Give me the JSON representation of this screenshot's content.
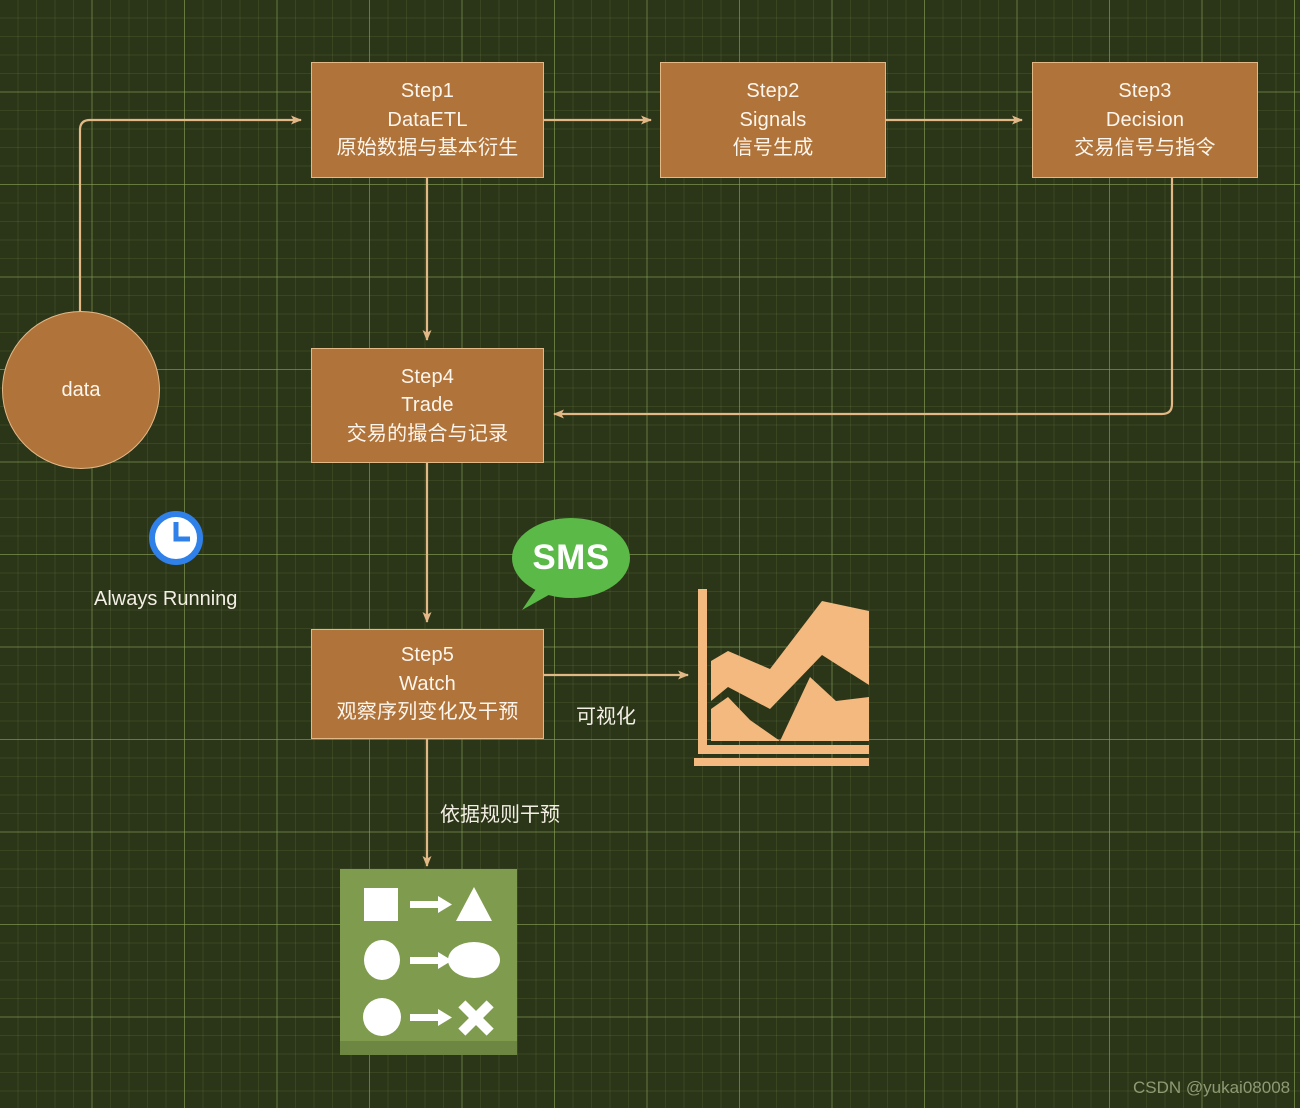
{
  "diagram": {
    "title": "Quant trading pipeline flowchart",
    "background_color": "#2b3518",
    "grid_color": "#8aa359",
    "node_fill": "#b0743a",
    "node_border": "#e3b887",
    "connector_color": "#e3b887",
    "nodes": [
      {
        "id": "data",
        "shape": "circle",
        "label": "data"
      },
      {
        "id": "step1",
        "shape": "rect",
        "line1": "Step1",
        "line2": "DataETL",
        "line3": "原始数据与基本衍生"
      },
      {
        "id": "step2",
        "shape": "rect",
        "line1": "Step2",
        "line2": "Signals",
        "line3": "信号生成"
      },
      {
        "id": "step3",
        "shape": "rect",
        "line1": "Step3",
        "line2": "Decision",
        "line3": "交易信号与指令"
      },
      {
        "id": "step4",
        "shape": "rect",
        "line1": "Step4",
        "line2": "Trade",
        "line3": "交易的撮合与记录"
      },
      {
        "id": "step5",
        "shape": "rect",
        "line1": "Step5",
        "line2": "Watch",
        "line3": "观察序列变化及干预"
      }
    ],
    "edge_labels": {
      "visualize": "可视化",
      "rule_intervene": "依据规则干预"
    },
    "annotations": {
      "always_running": "Always Running",
      "sms_badge": "SMS"
    },
    "icons": {
      "clock": "clock-icon",
      "sms": "sms-bubble-icon",
      "chart": "area-chart-icon",
      "rules": "shape-transform-rules-icon"
    },
    "icon_colors": {
      "clock_ring": "#2f80e8",
      "clock_face": "#ffffff",
      "sms_bubble": "#5bb947",
      "chart_fill": "#f3b97f",
      "rules_panel": "#7e9b4e",
      "rules_glyph": "#ffffff"
    }
  },
  "watermark": {
    "text": "CSDN @yukai08008"
  }
}
